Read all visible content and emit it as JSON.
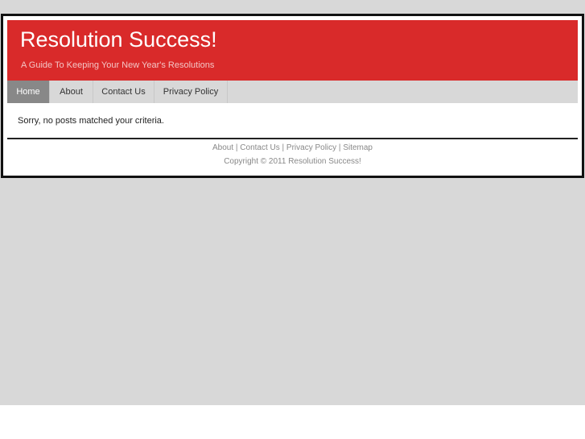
{
  "header": {
    "title": "Resolution Success!",
    "tagline": "A Guide To Keeping Your New Year's Resolutions"
  },
  "nav": {
    "items": [
      {
        "label": "Home",
        "active": true
      },
      {
        "label": "About",
        "active": false
      },
      {
        "label": "Contact Us",
        "active": false
      },
      {
        "label": "Privacy Policy",
        "active": false
      }
    ]
  },
  "content": {
    "message": "Sorry, no posts matched your criteria."
  },
  "footer": {
    "links": [
      "About",
      "Contact Us",
      "Privacy Policy",
      "Sitemap"
    ],
    "separator": " | ",
    "copyright": "Copyright © 2011 Resolution Success!"
  },
  "colors": {
    "header_bg": "#d92a2a",
    "nav_bg": "#d8d8d8",
    "nav_active_bg": "#888888",
    "page_bg": "#d8d8d8",
    "frame_border": "#111111"
  }
}
